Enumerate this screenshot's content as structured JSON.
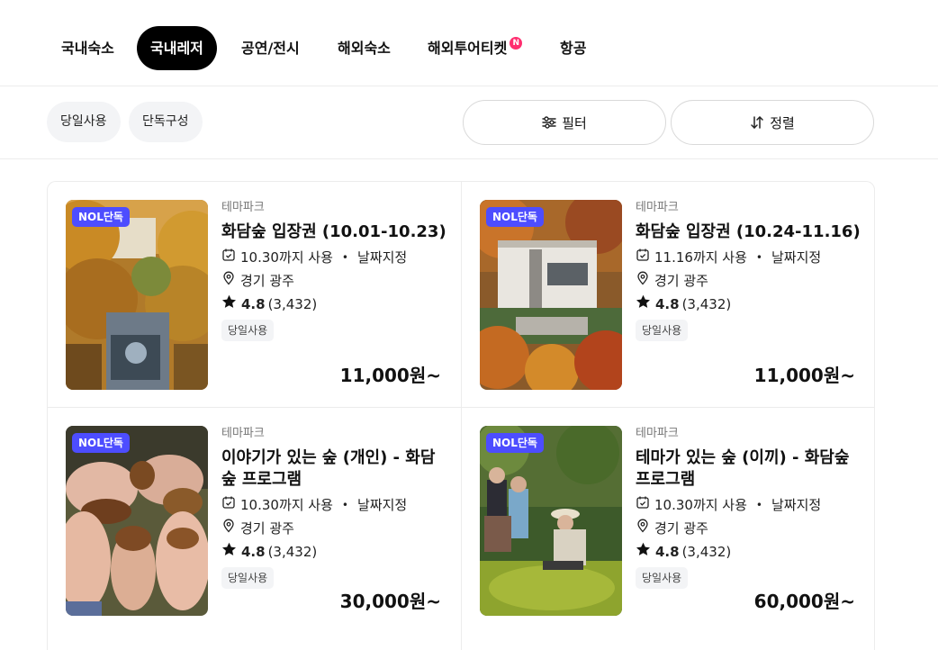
{
  "tabs": [
    {
      "label": "국내숙소"
    },
    {
      "label": "국내레저"
    },
    {
      "label": "공연/전시"
    },
    {
      "label": "해외숙소"
    },
    {
      "label": "해외투어티켓",
      "badge": "N"
    },
    {
      "label": "항공"
    }
  ],
  "filters": {
    "chips": [
      "당일사용",
      "단독구성"
    ],
    "filter_label": "필터",
    "sort_label": "정렬"
  },
  "products": [
    {
      "badge": "NOL단독",
      "category": "테마파크",
      "title": "화담숲 입장권 (10.01-10.23)",
      "validity": "10.30까지 사용",
      "date_option": "날짜지정",
      "location": "경기 광주",
      "rating": "4.8",
      "reviews": "(3,432)",
      "tag": "당일사용",
      "price": "11,000원~"
    },
    {
      "badge": "NOL단독",
      "category": "테마파크",
      "title": "화담숲 입장권 (10.24-11.16)",
      "validity": "11.16까지 사용",
      "date_option": "날짜지정",
      "location": "경기 광주",
      "rating": "4.8",
      "reviews": "(3,432)",
      "tag": "당일사용",
      "price": "11,000원~"
    },
    {
      "badge": "NOL단독",
      "category": "테마파크",
      "title": "이야기가 있는 숲 (개인) - 화담숲 프로그램",
      "validity": "10.30까지 사용",
      "date_option": "날짜지정",
      "location": "경기 광주",
      "rating": "4.8",
      "reviews": "(3,432)",
      "tag": "당일사용",
      "price": "30,000원~"
    },
    {
      "badge": "NOL단독",
      "category": "테마파크",
      "title": "테마가 있는 숲 (이끼) - 화담숲 프로그램",
      "validity": "10.30까지 사용",
      "date_option": "날짜지정",
      "location": "경기 광주",
      "rating": "4.8",
      "reviews": "(3,432)",
      "tag": "당일사용",
      "price": "60,000원~"
    }
  ],
  "colors": {
    "exclusive_badge": "#4d4dff",
    "new_badge": "#ff2d6f",
    "active_tab": "#000000"
  }
}
